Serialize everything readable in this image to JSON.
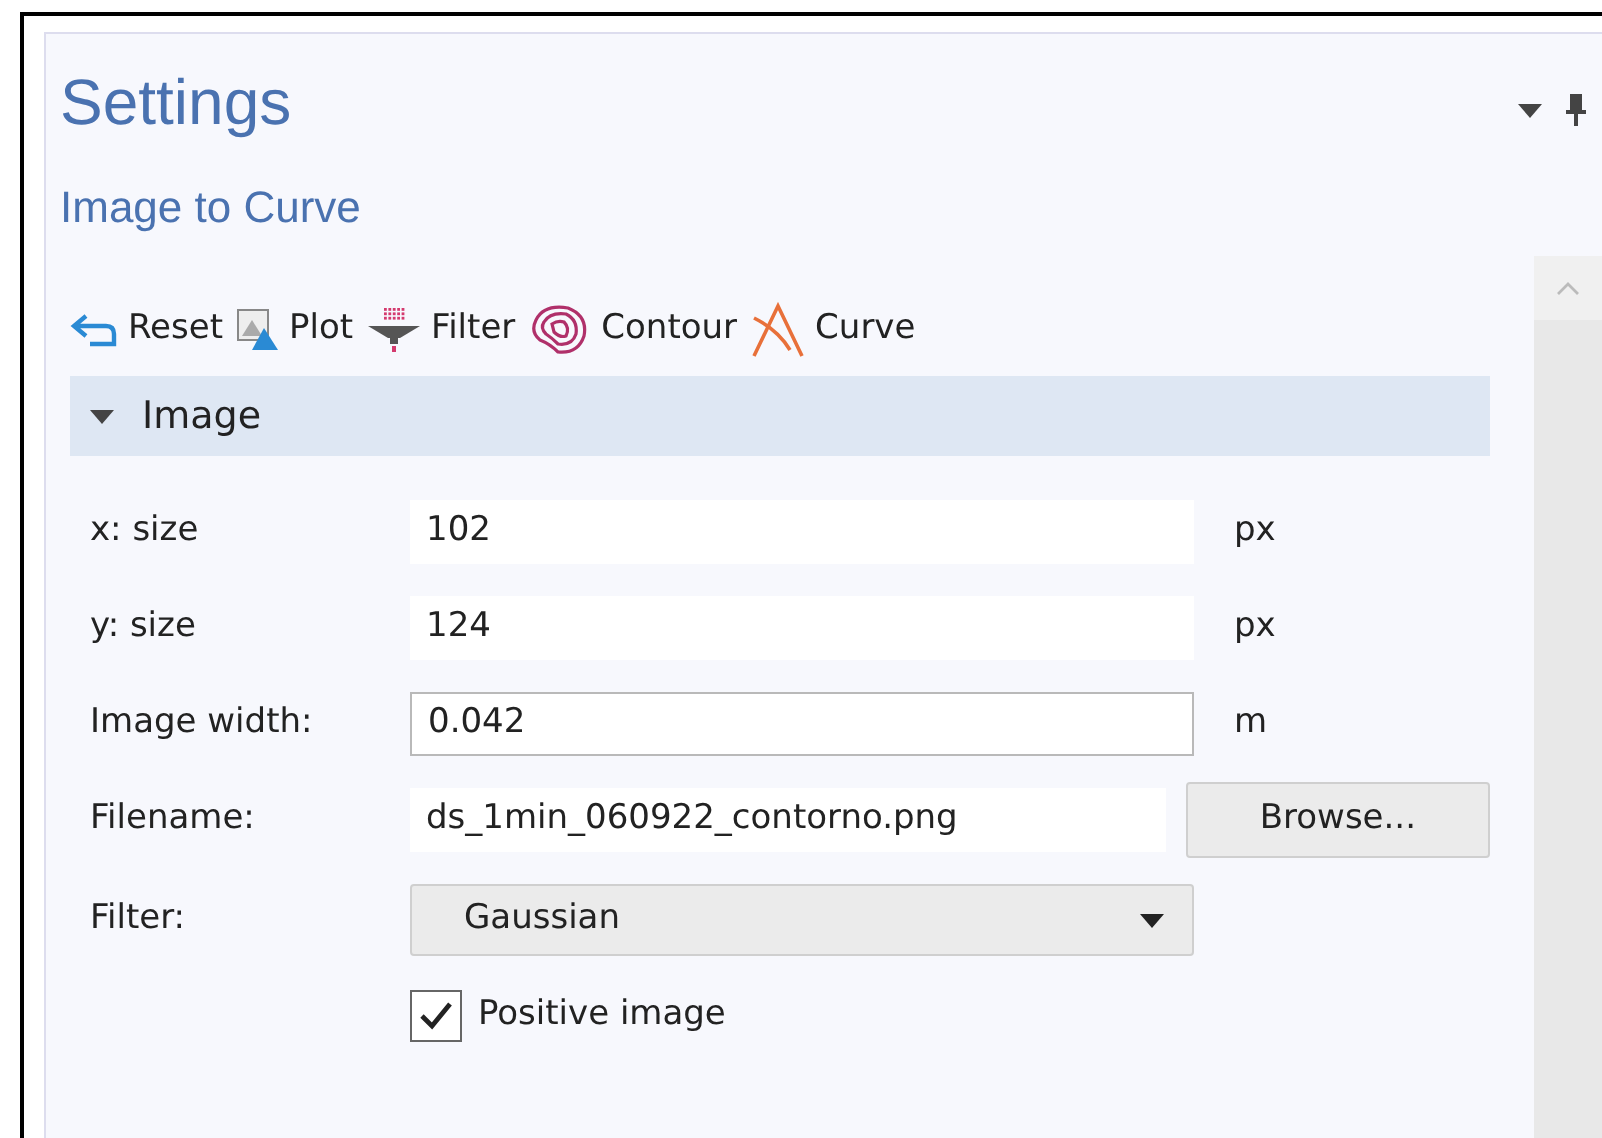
{
  "panel": {
    "title": "Settings",
    "subtitle": "Image to Curve"
  },
  "toolbar": [
    {
      "label": "Reset"
    },
    {
      "label": "Plot"
    },
    {
      "label": "Filter"
    },
    {
      "label": "Contour"
    },
    {
      "label": "Curve"
    }
  ],
  "section": {
    "title": "Image",
    "expanded": true
  },
  "rows": [
    {
      "kind": "readonly",
      "label": "x: size",
      "value": "102",
      "unit": "px"
    },
    {
      "kind": "readonly",
      "label": "y: size",
      "value": "124",
      "unit": "px"
    },
    {
      "kind": "input",
      "label": "Image width:",
      "value": "0.042",
      "unit": "m"
    },
    {
      "kind": "file",
      "label": "Filename:",
      "value": "ds_1min_060922_contorno.png",
      "button": "Browse..."
    },
    {
      "kind": "select",
      "label": "Filter:",
      "value": "Gaussian"
    },
    {
      "kind": "checkbox",
      "label": "Positive image",
      "checked": true
    }
  ]
}
